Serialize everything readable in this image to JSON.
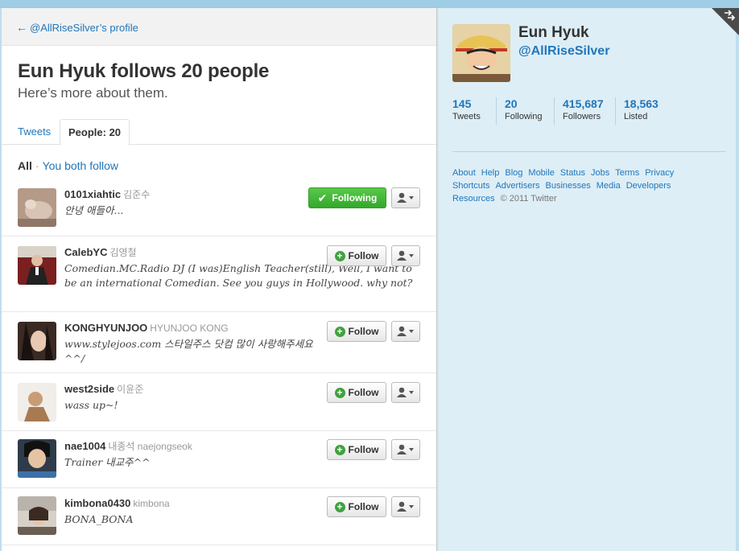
{
  "back_link": {
    "arrow": "←",
    "label": "@AllRiseSilver’s profile"
  },
  "heading": {
    "title": "Eun Hyuk follows 20 people",
    "subtitle": "Here’s more about them."
  },
  "tabs": {
    "tweets": "Tweets",
    "people": "People: 20"
  },
  "filter": {
    "all": "All",
    "separator": "·",
    "both": "You both follow"
  },
  "users": [
    {
      "username": "0101xiahtic",
      "fullname": "김준수",
      "bio": "안녕 애들아...",
      "button": "Following"
    },
    {
      "username": "CalebYC",
      "fullname": "김영철",
      "bio": "Comedian.MC.Radio DJ (I was)English Teacher(still), Well, I want to be an international Comedian. See you guys in Hollywood. why not?",
      "button": "Follow"
    },
    {
      "username": "KONGHYUNJOO",
      "fullname": "HYUNJOO KONG",
      "bio": "www.stylejoos.com 스타일주스 닷컴 많이 사랑해주세요^^/",
      "button": "Follow"
    },
    {
      "username": "west2side",
      "fullname": "이윤준",
      "bio": "wass up~!",
      "button": "Follow"
    },
    {
      "username": "nae1004",
      "fullname": "내종석 naejongseok",
      "bio": "Trainer 내교주^^",
      "button": "Follow"
    },
    {
      "username": "kimbona0430",
      "fullname": "kimbona",
      "bio": "BONA_BONA",
      "button": "Follow"
    }
  ],
  "buttons": {
    "plus_glyph": "+",
    "check_glyph": "✔"
  },
  "profile": {
    "name": "Eun Hyuk",
    "handle": "@AllRiseSilver",
    "stats": [
      {
        "value": "145",
        "label": "Tweets"
      },
      {
        "value": "20",
        "label": "Following"
      },
      {
        "value": "415,687",
        "label": "Followers"
      },
      {
        "value": "18,563",
        "label": "Listed"
      }
    ]
  },
  "footer": {
    "links": [
      "About",
      "Help",
      "Blog",
      "Mobile",
      "Status",
      "Jobs",
      "Terms",
      "Privacy",
      "Shortcuts",
      "Advertisers",
      "Businesses",
      "Media",
      "Developers",
      "Resources"
    ],
    "copyright": "© 2011 Twitter"
  },
  "colors": {
    "link": "#2276bb",
    "following_green": "#3fae34",
    "page_bg": "#c0deed"
  }
}
